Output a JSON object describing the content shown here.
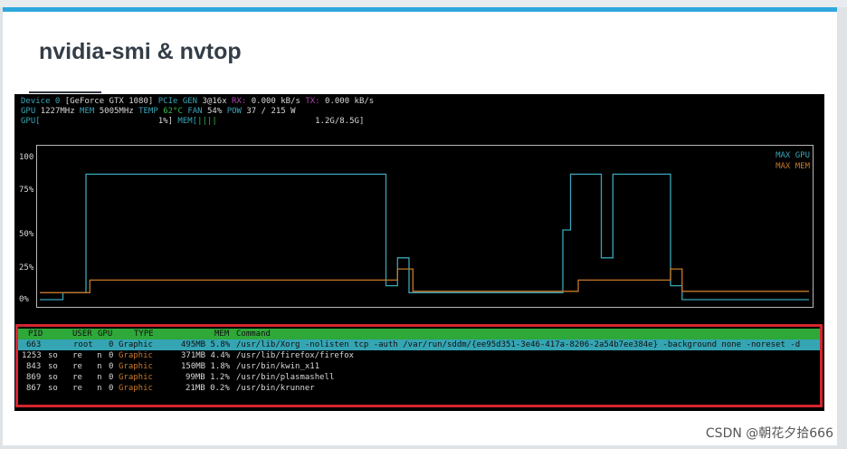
{
  "slide": {
    "title": "nvidia-smi & nvtop"
  },
  "header": {
    "device_label": "Device 0",
    "device_name": "[GeForce GTX 1080]",
    "pcie_label": "PCIe GEN",
    "pcie_value": "3@16x",
    "rx_label": "RX:",
    "rx_value": "0.000 kB/s",
    "tx_label": "TX:",
    "tx_value": "0.000 kB/s",
    "gpu_label": "GPU",
    "gpu_clock": "1227MHz",
    "mem_label": "MEM",
    "mem_clock": "5005MHz",
    "temp_label": "TEMP",
    "temp_value": "62°C",
    "fan_label": "FAN",
    "fan_value": "54%",
    "pow_label": "POW",
    "pow_value": "37 / 215 W",
    "gpu_bar_label": "GPU[",
    "gpu_bar_value": "1%]",
    "mem_bar_label": "MEM[",
    "mem_bar_fill": "||||",
    "mem_bar_value": "1.2G/8.5G]"
  },
  "graph": {
    "y_labels": [
      "100",
      "75%",
      "50%",
      "25%",
      "0%"
    ],
    "legend_gpu": "MAX GPU",
    "legend_mem": "MAX MEM",
    "colors": {
      "gpu": "#3aa5b8",
      "mem": "#c6782b"
    }
  },
  "chart_data": {
    "type": "line",
    "ylim": [
      0,
      100
    ],
    "series": [
      {
        "name": "MAX GPU",
        "points": [
          [
            0,
            0
          ],
          [
            3,
            0
          ],
          [
            3,
            5
          ],
          [
            6,
            5
          ],
          [
            6,
            90
          ],
          [
            45,
            90
          ],
          [
            45,
            10
          ],
          [
            46.5,
            10
          ],
          [
            46.5,
            30
          ],
          [
            48,
            30
          ],
          [
            48,
            5
          ],
          [
            68,
            5
          ],
          [
            68,
            50
          ],
          [
            69,
            50
          ],
          [
            69,
            90
          ],
          [
            73,
            90
          ],
          [
            73,
            30
          ],
          [
            74.5,
            30
          ],
          [
            74.5,
            90
          ],
          [
            82,
            90
          ],
          [
            82,
            10
          ],
          [
            83.5,
            10
          ],
          [
            83.5,
            0
          ],
          [
            100,
            0
          ]
        ]
      },
      {
        "name": "MAX MEM",
        "points": [
          [
            0,
            5
          ],
          [
            6.5,
            5
          ],
          [
            6.5,
            14
          ],
          [
            45,
            14
          ],
          [
            45,
            14
          ],
          [
            46.5,
            14
          ],
          [
            46.5,
            22
          ],
          [
            48.5,
            22
          ],
          [
            48.5,
            6
          ],
          [
            70,
            6
          ],
          [
            70,
            14
          ],
          [
            82,
            14
          ],
          [
            82,
            22
          ],
          [
            83.5,
            22
          ],
          [
            83.5,
            6
          ],
          [
            100,
            6
          ]
        ]
      }
    ]
  },
  "processes": {
    "header": {
      "pid": "PID",
      "user": "USER",
      "gpu": "GPU",
      "type": "TYPE",
      "mem": "MEM",
      "command": "Command"
    },
    "rows": [
      {
        "pid": "663",
        "user": "root",
        "gpu": "0",
        "type": "Graphic",
        "mem": "495MB 5.8%",
        "command": "/usr/lib/Xorg -nolisten tcp -auth /var/run/sddm/{ee95d351-3e46-417a-8206-2a54b7ee384e} -background none -noreset -d"
      },
      {
        "pid": "1253",
        "user": "so   re   n",
        "gpu": "0",
        "type": "Graphic",
        "mem": "371MB 4.4%",
        "command": "/usr/lib/firefox/firefox"
      },
      {
        "pid": "843",
        "user": "so   re   n",
        "gpu": "0",
        "type": "Graphic",
        "mem": "150MB 1.8%",
        "command": "/usr/bin/kwin_x11"
      },
      {
        "pid": "869",
        "user": "so   re   n",
        "gpu": "0",
        "type": "Graphic",
        "mem": "99MB 1.2%",
        "command": "/usr/bin/plasmashell"
      },
      {
        "pid": "867",
        "user": "so   re   n",
        "gpu": "0",
        "type": "Graphic",
        "mem": "21MB 0.2%",
        "command": "/usr/bin/krunner"
      }
    ]
  },
  "watermark": "CSDN @朝花夕拾666"
}
